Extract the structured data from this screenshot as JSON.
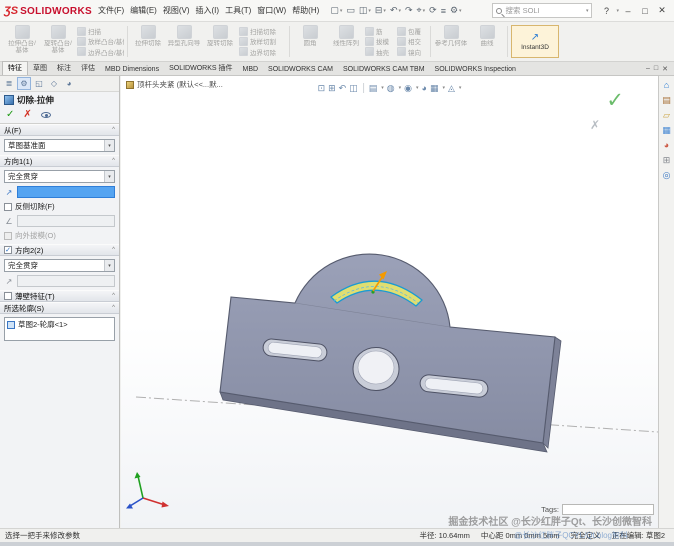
{
  "ui": {
    "caret_down": "▾",
    "chevron_up": "^",
    "check": "✓"
  },
  "colors": {
    "logo_red": "#c8102e",
    "selection_blue": "#55a4f1",
    "part_gray": "#8e94ab",
    "sketch_highlight_yellow": "#e4e26e",
    "sketch_edge_blue": "#1b9ad2",
    "confirm_green": "#52b152"
  },
  "titlebar": {
    "logo_mark": "ƷS",
    "logo_name": "SOLIDWORKS",
    "menus": [
      "文件(F)",
      "编辑(E)",
      "视图(V)",
      "插入(I)",
      "工具(T)",
      "窗口(W)",
      "帮助(H)"
    ],
    "qat": [
      {
        "name": "new",
        "glyph": "▢"
      },
      {
        "name": "open",
        "glyph": "▭"
      },
      {
        "name": "save",
        "glyph": "◫"
      },
      {
        "name": "print",
        "glyph": "⊟"
      },
      {
        "name": "undo",
        "glyph": "↶"
      },
      {
        "name": "redo",
        "glyph": "↷"
      },
      {
        "name": "select",
        "glyph": "⌖"
      },
      {
        "name": "rebuild",
        "glyph": "⟳"
      },
      {
        "name": "file-properties",
        "glyph": "≡"
      },
      {
        "name": "options",
        "glyph": "⚙"
      }
    ],
    "search_placeholder": "搜索 SOLI",
    "help_glyph": "?",
    "minimize_glyph": "–",
    "maximize_glyph": "□",
    "close_glyph": "✕"
  },
  "ribbon": {
    "groups": [
      {
        "big": [
          "拉伸凸台/基体",
          "旋转凸台/基体"
        ],
        "small": [
          "扫描",
          "放样凸台/基体",
          "边界凸台/基体"
        ]
      },
      {
        "big": [
          "拉伸切除",
          "异型孔向导",
          "旋转切除"
        ],
        "small": [
          "扫描切除",
          "放样切割",
          "边界切除"
        ]
      },
      {
        "big": [
          "圆角",
          "线性阵列"
        ],
        "small": [
          "筋",
          "拔模",
          "抽壳"
        ],
        "small2": [
          "包覆",
          "相交",
          "镜向"
        ]
      },
      {
        "big": [
          "参考几何体",
          "曲线"
        ]
      },
      {
        "instant3d": "Instant3D",
        "instant3d_glyph": "↗"
      }
    ]
  },
  "command_tabs": {
    "items": [
      "特征",
      "草图",
      "标注",
      "评估",
      "MBD Dimensions",
      "SOLIDWORKS 插件",
      "MBD",
      "SOLIDWORKS CAM",
      "SOLIDWORKS CAM TBM",
      "SOLIDWORKS Inspection"
    ],
    "active_index": 0,
    "doc_minimize": "–",
    "doc_restore": "□",
    "doc_close": "✕"
  },
  "property_manager": {
    "tab_icons": [
      "≣",
      "⚙",
      "◱",
      "◇",
      "◕"
    ],
    "title": "切除-拉伸",
    "ok_glyph": "✓",
    "cancel_glyph": "✗",
    "sections": {
      "from": {
        "header": "从(F)",
        "value": "草图基准面"
      },
      "direction1": {
        "header": "方向1(1)",
        "end_condition": "完全贯穿",
        "flip_glyph": "↗",
        "reverse_checkbox": "反侧切除(F)",
        "draft_glyph": "∠",
        "outward_draft_checkbox": "向外拔模(O)"
      },
      "direction2": {
        "header": "方向2(2)",
        "end_condition": "完全贯穿",
        "flip_glyph": "↗",
        "check_glyph": "✓"
      },
      "thin_feature": {
        "header": "薄壁特征(T)"
      },
      "contours": {
        "header": "所选轮廓(S)",
        "items": [
          "草图2-轮廓<1>"
        ]
      }
    }
  },
  "viewport": {
    "document_tab": "顶杆头夹紧 (默认<<...默...",
    "hud": [
      {
        "name": "zoom-fit",
        "glyph": "⊡"
      },
      {
        "name": "zoom-area",
        "glyph": "⊞"
      },
      {
        "name": "previous-view",
        "glyph": "↶"
      },
      {
        "name": "section-view",
        "glyph": "◫"
      },
      {
        "name": "view-orientation",
        "glyph": "▤"
      },
      {
        "name": "display-style",
        "glyph": "◍"
      },
      {
        "name": "hide-show-items",
        "glyph": "◉"
      },
      {
        "name": "edit-appearance",
        "glyph": "◕"
      },
      {
        "name": "apply-scene",
        "glyph": "▦"
      },
      {
        "name": "view-settings",
        "glyph": "◬"
      }
    ],
    "confirm_glyph": "✓",
    "cancel_glyph": "✗",
    "tags_label": "Tags:",
    "watermark": "掘金技术社区 @长沙红胖子Qt、长沙创微智科",
    "watermark_overlay": "@长沙红胖子QCYL/Qt.blog智科"
  },
  "task_pane": [
    {
      "name": "solidworks-resources",
      "glyph": "⌂"
    },
    {
      "name": "design-library",
      "glyph": "▤"
    },
    {
      "name": "file-explorer",
      "glyph": "▱"
    },
    {
      "name": "view-palette",
      "glyph": "▦"
    },
    {
      "name": "appearances-scenes",
      "glyph": "◕"
    },
    {
      "name": "custom-properties",
      "glyph": "⊞"
    },
    {
      "name": "solidworks-forum",
      "glyph": "◎"
    }
  ],
  "statusbar": {
    "message": "选择一把手来修改参数",
    "measurement": "半径: 10.64mm",
    "coordinates": "中心距 0mm 0mm 5mm",
    "constraint_status": "完全定义",
    "editing_status": "正在编辑: 草图2"
  }
}
